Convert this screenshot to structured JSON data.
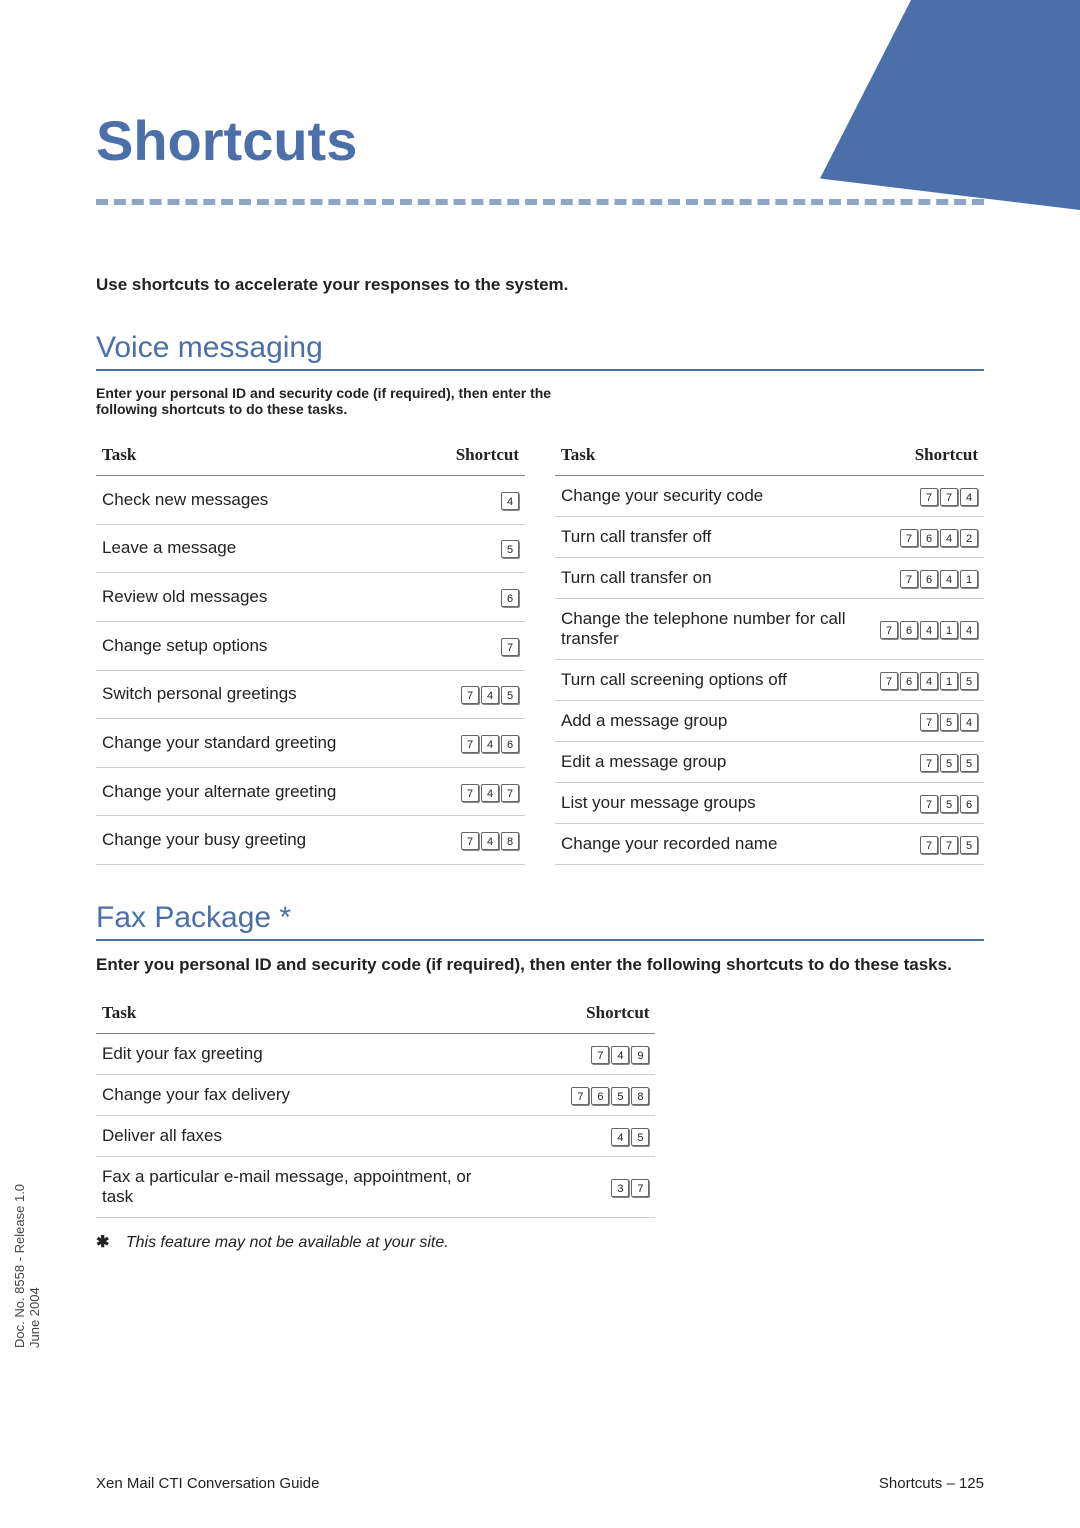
{
  "title": "Shortcuts",
  "intro": "Use shortcuts to accelerate your responses to the system.",
  "vm": {
    "heading": "Voice messaging",
    "sub": "Enter your personal ID and security code (if required), then enter the following shortcuts to do these tasks.",
    "col_task": "Task",
    "col_shortcut": "Shortcut",
    "left": [
      {
        "task": "Check new messages",
        "sc": [
          "4"
        ]
      },
      {
        "task": "Leave a message",
        "sc": [
          "5"
        ]
      },
      {
        "task": "Review old messages",
        "sc": [
          "6"
        ]
      },
      {
        "task": "Change setup options",
        "sc": [
          "7"
        ]
      },
      {
        "task": "Switch personal greetings",
        "sc": [
          "7",
          "4",
          "5"
        ]
      },
      {
        "task": "Change your standard greeting",
        "sc": [
          "7",
          "4",
          "6"
        ]
      },
      {
        "task": "Change your alternate greeting",
        "sc": [
          "7",
          "4",
          "7"
        ]
      },
      {
        "task": "Change your busy greeting",
        "sc": [
          "7",
          "4",
          "8"
        ]
      }
    ],
    "right": [
      {
        "task": "Change your security code",
        "sc": [
          "7",
          "7",
          "4"
        ]
      },
      {
        "task": "Turn call transfer off",
        "sc": [
          "7",
          "6",
          "4",
          "2"
        ]
      },
      {
        "task": "Turn call transfer on",
        "sc": [
          "7",
          "6",
          "4",
          "1"
        ]
      },
      {
        "task": "Change the telephone number for call transfer",
        "sc": [
          "7",
          "6",
          "4",
          "1",
          "4"
        ]
      },
      {
        "task": "Turn call screening options off",
        "sc": [
          "7",
          "6",
          "4",
          "1",
          "5"
        ]
      },
      {
        "task": "Add a message group",
        "sc": [
          "7",
          "5",
          "4"
        ]
      },
      {
        "task": "Edit a message group",
        "sc": [
          "7",
          "5",
          "5"
        ]
      },
      {
        "task": "List your message groups",
        "sc": [
          "7",
          "5",
          "6"
        ]
      },
      {
        "task": "Change your recorded name",
        "sc": [
          "7",
          "7",
          "5"
        ]
      }
    ]
  },
  "fax": {
    "heading": "Fax Package *",
    "sub": "Enter you personal ID and security code (if required), then enter the following shortcuts to do these tasks.",
    "col_task": "Task",
    "col_shortcut": "Shortcut",
    "rows": [
      {
        "task": "Edit your fax greeting",
        "sc": [
          "7",
          "4",
          "9"
        ]
      },
      {
        "task": "Change your fax delivery",
        "sc": [
          "7",
          "6",
          "5",
          "8"
        ]
      },
      {
        "task": "Deliver all faxes",
        "sc": [
          "4",
          "5"
        ]
      },
      {
        "task": "Fax a particular e-mail message, appointment, or task",
        "sc": [
          "3",
          "7"
        ]
      }
    ],
    "note_mark": "✱",
    "note": "This feature may not be available at your site."
  },
  "side1": "Doc. No. 8558 - Release 1.0",
  "side2": "June 2004",
  "footer_left": "Xen Mail CTI Conversation Guide",
  "footer_right": "Shortcuts – 125"
}
